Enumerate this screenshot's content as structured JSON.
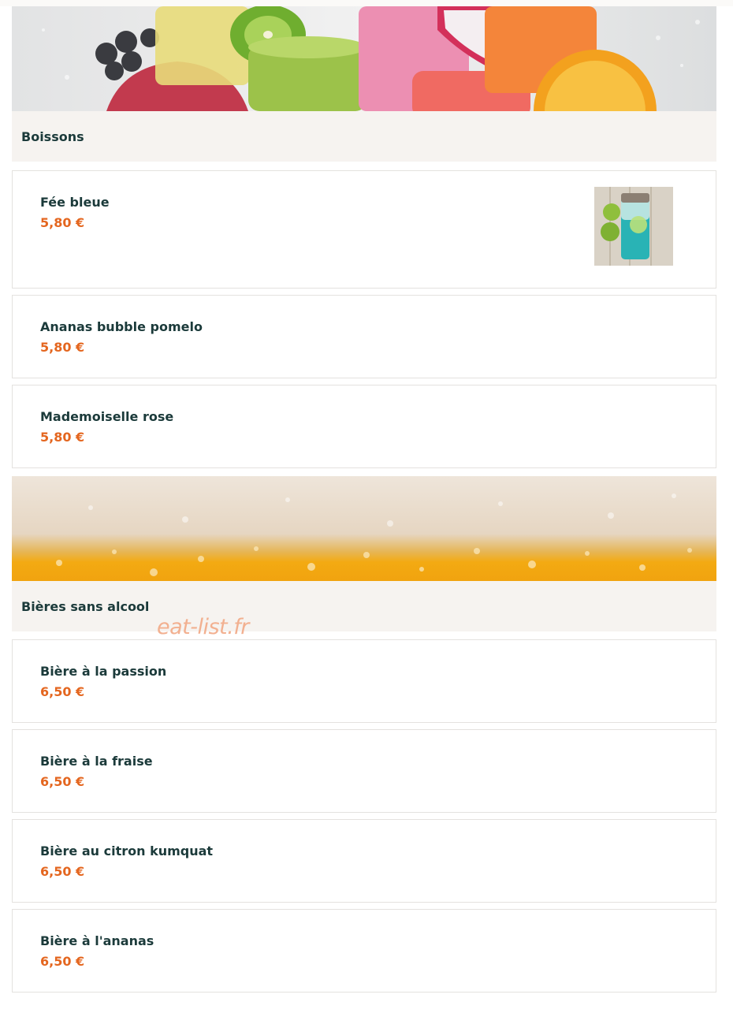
{
  "categories": [
    {
      "title": "Boissons",
      "banner_icon": "fruit-juices-photo",
      "items": [
        {
          "name": "Fée bleue",
          "price": "5,80 €",
          "thumbnail_icon": "blue-drink-jar-photo"
        },
        {
          "name": "Ananas bubble pomelo",
          "price": "5,80 €"
        },
        {
          "name": "Mademoiselle rose",
          "price": "5,80 €"
        }
      ]
    },
    {
      "title": "Bières sans alcool",
      "banner_icon": "beer-foam-photo",
      "items": [
        {
          "name": "Bière à la passion",
          "price": "6,50 €"
        },
        {
          "name": "Bière à la fraise",
          "price": "6,50 €"
        },
        {
          "name": "Bière au citron kumquat",
          "price": "6,50 €"
        },
        {
          "name": "Bière à l'ananas",
          "price": "6,50 €"
        }
      ]
    }
  ],
  "watermark": "eat-list.fr",
  "colors": {
    "title_text": "#1b3a3a",
    "price_text": "#e4661f",
    "category_bar": "#f6f3f0",
    "card_border": "#e4e2df",
    "watermark": "#f2b090"
  }
}
